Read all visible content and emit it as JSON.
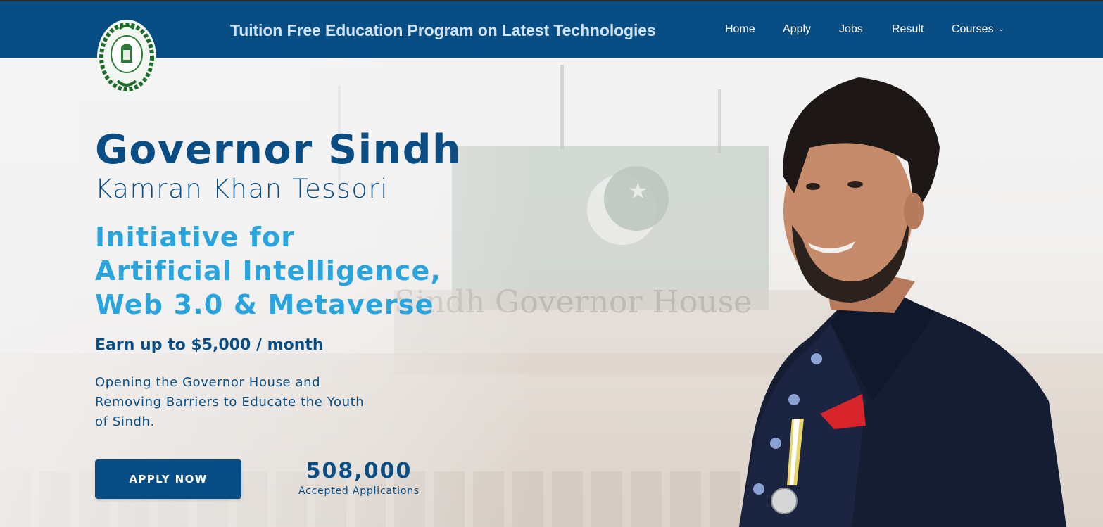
{
  "header": {
    "tagline": "Tuition Free Education Program on Latest Technologies",
    "nav": [
      {
        "label": "Home"
      },
      {
        "label": "Apply"
      },
      {
        "label": "Jobs"
      },
      {
        "label": "Result"
      },
      {
        "label": "Courses",
        "icon": "chevron-down-icon"
      }
    ],
    "logo_icon": "governor-sindh-emblem-icon"
  },
  "hero": {
    "title": "Governor Sindh",
    "subtitle": "Kamran Khan Tessori",
    "initiative_lines": [
      "Initiative for",
      "Artificial Intelligence,",
      "Web 3.0 & Metaverse"
    ],
    "earn": "Earn up to $5,000 / month",
    "description": "Opening the Governor House and Removing Barriers to Educate the Youth of Sindh.",
    "cta_label": "APPLY NOW",
    "stat_value": "508,000",
    "stat_label": "Accepted Applications",
    "background_sign": "Sindh Governor House"
  },
  "colors": {
    "header_bg": "#084d84",
    "primary_text": "#094d84",
    "accent_blue": "#2aa4dc",
    "tagline": "#cfe3f5"
  }
}
